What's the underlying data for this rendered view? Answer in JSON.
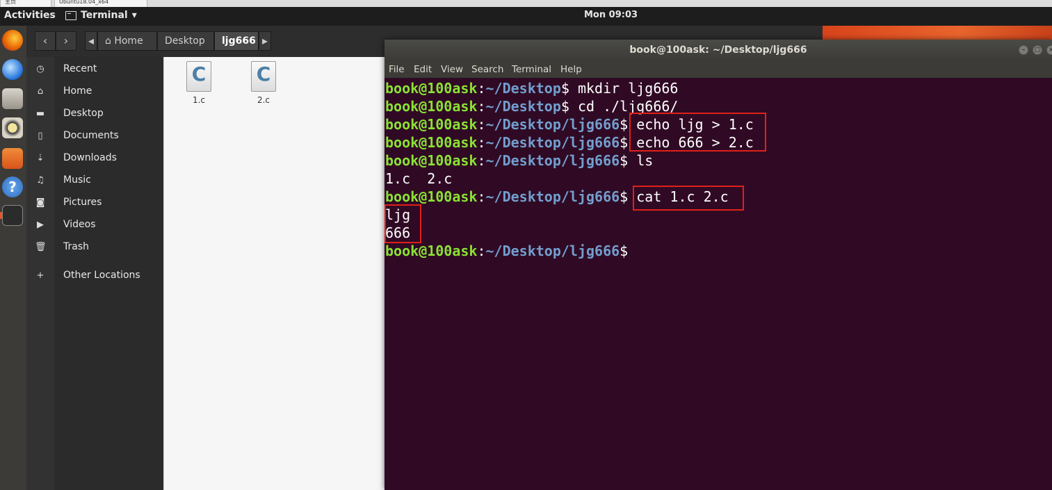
{
  "host_tabs": [
    "主页",
    "Ubuntu18.04_x64"
  ],
  "topbar": {
    "activities": "Activities",
    "app_name": "Terminal",
    "app_arrow": "▾",
    "clock": "Mon 09:03"
  },
  "dock": {
    "items": [
      "firefox-icon",
      "thunderbird-icon",
      "files-icon",
      "rhythmbox-icon",
      "software-center-icon",
      "help-icon",
      "terminal-icon"
    ]
  },
  "nautilus": {
    "breadcrumbs": [
      "Home",
      "Desktop",
      "ljg666"
    ],
    "sidebar": [
      {
        "label": "Recent",
        "icon": "clock-icon"
      },
      {
        "label": "Home",
        "icon": "home-icon"
      },
      {
        "label": "Desktop",
        "icon": "folder-icon"
      },
      {
        "label": "Documents",
        "icon": "document-icon"
      },
      {
        "label": "Downloads",
        "icon": "download-icon"
      },
      {
        "label": "Music",
        "icon": "music-icon"
      },
      {
        "label": "Pictures",
        "icon": "camera-icon"
      },
      {
        "label": "Videos",
        "icon": "video-icon"
      },
      {
        "label": "Trash",
        "icon": "trash-icon"
      },
      {
        "label": "Other Locations",
        "icon": "plus-icon"
      }
    ],
    "files": [
      {
        "name": "1.c",
        "glyph": "C"
      },
      {
        "name": "2.c",
        "glyph": "C"
      }
    ]
  },
  "terminal": {
    "title": "book@100ask: ~/Desktop/ljg666",
    "menu": [
      "File",
      "Edit",
      "View",
      "Search",
      "Terminal",
      "Help"
    ],
    "lines": [
      {
        "user": "book@100ask",
        "sep": ":",
        "path": "~/Desktop",
        "cmd": "$ mkdir ljg666"
      },
      {
        "user": "book@100ask",
        "sep": ":",
        "path": "~/Desktop",
        "cmd": "$ cd ./ljg666/"
      },
      {
        "user": "book@100ask",
        "sep": ":",
        "path": "~/Desktop/ljg666",
        "cmd": "$ echo ljg > 1.c"
      },
      {
        "user": "book@100ask",
        "sep": ":",
        "path": "~/Desktop/ljg666",
        "cmd": "$ echo 666 > 2.c"
      },
      {
        "user": "book@100ask",
        "sep": ":",
        "path": "~/Desktop/ljg666",
        "cmd": "$ ls"
      },
      {
        "output": "1.c  2.c"
      },
      {
        "user": "book@100ask",
        "sep": ":",
        "path": "~/Desktop/ljg666",
        "cmd": "$ cat 1.c 2.c"
      },
      {
        "output": "ljg"
      },
      {
        "output": "666"
      },
      {
        "user": "book@100ask",
        "sep": ":",
        "path": "~/Desktop/ljg666",
        "cmd": "$"
      }
    ]
  },
  "colors": {
    "terminal_bg": "#300a24",
    "prompt_user": "#8ae234",
    "prompt_path": "#729fcf",
    "highlight_box": "#e0201b",
    "accent": "#e95420"
  }
}
